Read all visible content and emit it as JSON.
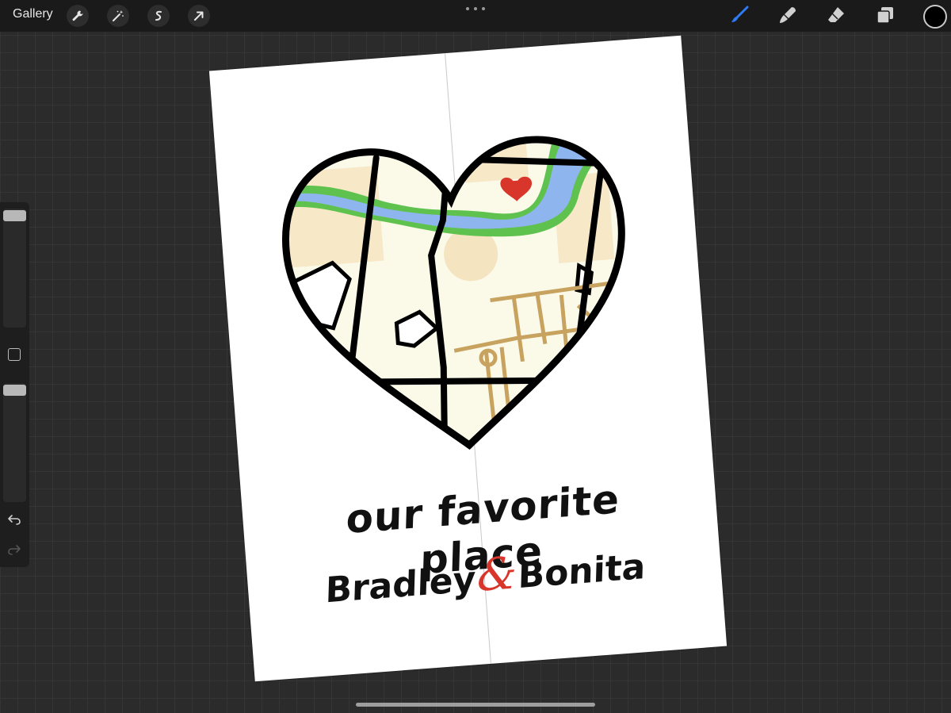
{
  "topbar": {
    "gallery_label": "Gallery",
    "tools": [
      "wrench-icon",
      "magic-wand-icon",
      "selection-icon",
      "transform-icon"
    ],
    "right_tools": [
      "brush-icon",
      "smudge-icon",
      "eraser-icon",
      "layers-icon"
    ],
    "active_color": "#000000",
    "accent": "#2f7bf5"
  },
  "artwork": {
    "title": "our favorite place",
    "name_left": "Bradley",
    "ampersand": "&",
    "name_right": "Bonita",
    "heart_marker_color": "#d9362b"
  }
}
